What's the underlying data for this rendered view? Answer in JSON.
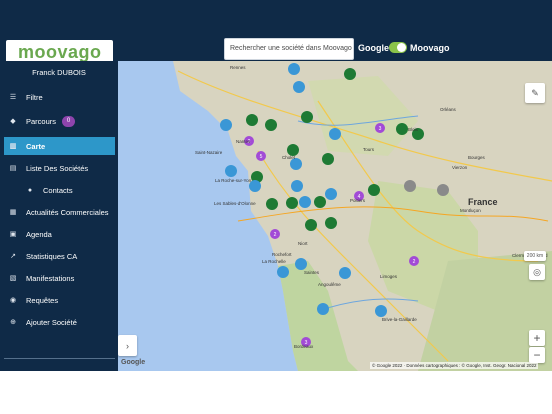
{
  "header": {
    "logo_text": "moovago",
    "search_placeholder": "Rechercher une société dans Moovago",
    "google_label": "Google",
    "moovago_label": "Moovago"
  },
  "user": {
    "name": "Franck DUBOIS"
  },
  "sidebar": {
    "items": [
      {
        "label": "Filtre",
        "icon": "filter-icon"
      },
      {
        "label": "Parcours",
        "icon": "route-icon",
        "badge": "0"
      },
      {
        "label": "Carte",
        "icon": "map-icon"
      },
      {
        "label": "Liste Des Sociétés",
        "icon": "building-icon"
      },
      {
        "label": "Contacts",
        "icon": "users-icon"
      },
      {
        "label": "Actualités Commerciales",
        "icon": "news-icon"
      },
      {
        "label": "Agenda",
        "icon": "calendar-icon"
      },
      {
        "label": "Statistiques CA",
        "icon": "stats-icon"
      },
      {
        "label": "Manifestations",
        "icon": "event-icon"
      },
      {
        "label": "Requêtes",
        "icon": "query-icon"
      },
      {
        "label": "Ajouter Société",
        "icon": "add-icon"
      }
    ]
  },
  "map": {
    "country": "France",
    "cities": [
      "Rennes",
      "Nantes",
      "Saint-Nazaire",
      "Cholet",
      "La Roche-sur-Yon",
      "Les Sables-d'Olonne",
      "Poitiers",
      "Niort",
      "La Rochelle",
      "Rochefort",
      "Angoulême",
      "Saintes",
      "Bordeaux",
      "Limoges",
      "Tours",
      "Blois",
      "Orléans",
      "Bourges",
      "Montluçon",
      "Brive-la-Gaillarde",
      "Clermont-Ferrand",
      "Vierzon"
    ],
    "scale_label": "200 km",
    "attribution": "© Google 2022 · Données cartographiques : © Google, Inst. Geogr. Nacional 2022",
    "google_mark": "Google",
    "clusters": [
      "2",
      "3",
      "5",
      "4",
      "2",
      "2",
      "3"
    ],
    "marker_colors": {
      "blue": "#3a97d6",
      "green": "#1e7a34",
      "grey": "#8a8a8a",
      "cluster": "#a24bd6"
    }
  }
}
